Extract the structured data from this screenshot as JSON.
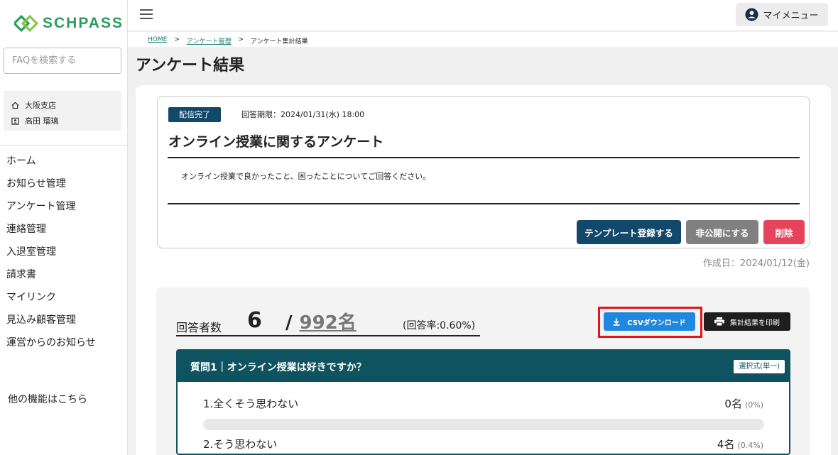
{
  "app": {
    "logo_text": "SCHPASS"
  },
  "sidebar": {
    "faq_placeholder": "FAQを検索する",
    "branch": "大阪支店",
    "user": "高田 瑠璃",
    "items": [
      "ホーム",
      "お知らせ管理",
      "アンケート管理",
      "連絡管理",
      "入退室管理",
      "請求書",
      "マイリンク",
      "見込み顧客管理",
      "運営からのお知らせ"
    ],
    "other_features": "他の機能はこちら"
  },
  "header": {
    "my_menu": "マイメニュー"
  },
  "breadcrumb": {
    "home": "HOME",
    "survey_mgmt": "アンケート管理",
    "current": "アンケート集計結果"
  },
  "page": {
    "title": "アンケート結果"
  },
  "survey": {
    "status_badge": "配信完了",
    "deadline": "回答期限：2024/01/31(水) 18:00",
    "title": "オンライン授業に関するアンケート",
    "description": "オンライン授業で良かったこと、困ったことについてご回答ください。",
    "template_button": "テンプレート登録する",
    "private_button": "非公開にする",
    "delete_button": "削除",
    "created": "作成日：2024/01/12(金)"
  },
  "results": {
    "respondents_label": "回答者数",
    "count": "6",
    "separator": "/",
    "total": "992名",
    "rate": "(回答率:0.60%)",
    "csv_button": "CSVダウンロード",
    "print_button": "集計結果を印刷"
  },
  "question": {
    "title": "質問1｜オンライン授業は好きですか？",
    "type": "選択式(単一)",
    "options": [
      {
        "label": "1.全くそう思わない",
        "count": "0名",
        "percent": "(0%)",
        "ratio": 0
      },
      {
        "label": "2.そう思わない",
        "count": "4名",
        "percent": "(0.4%)",
        "ratio": 0.004
      }
    ]
  },
  "colors": {
    "brand_green": "#2a9d5c",
    "navy": "#12486a",
    "teal": "#0f5260",
    "delete_red": "#e5445b",
    "csv_blue": "#1e88e0",
    "highlight_red": "#e4141e"
  }
}
